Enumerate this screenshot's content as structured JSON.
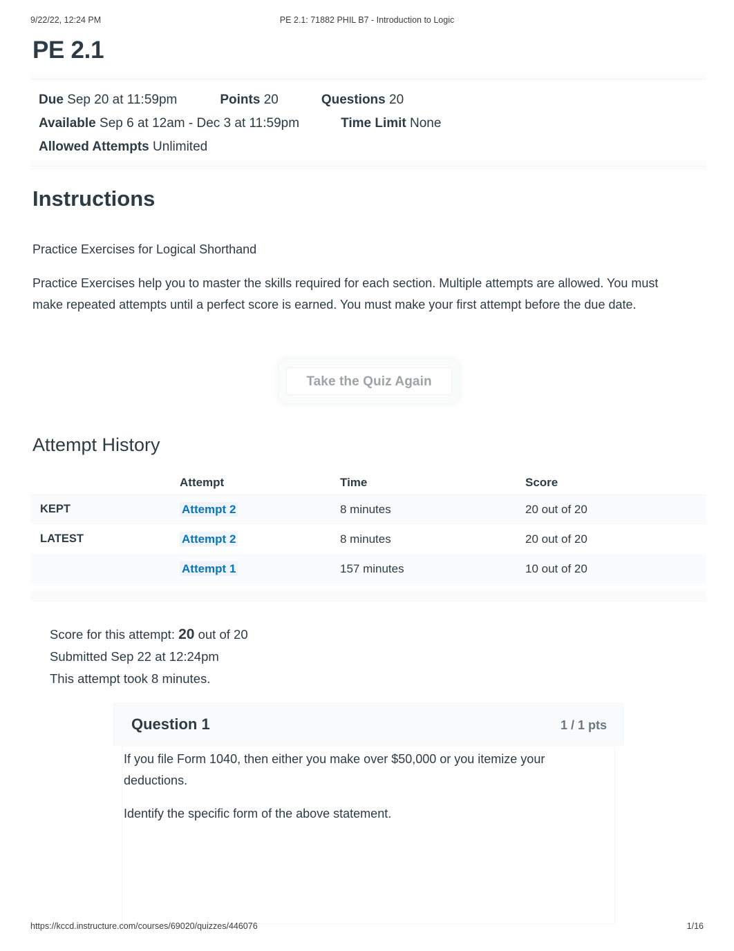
{
  "print_header": {
    "date": "9/22/22, 12:24 PM",
    "title": "PE 2.1: 71882 PHIL B7 - Introduction to Logic"
  },
  "quiz": {
    "title": "PE 2.1"
  },
  "meta": {
    "due_label": "Due",
    "due_value": "Sep 20 at 11:59pm",
    "points_label": "Points",
    "points_value": "20",
    "questions_label": "Questions",
    "questions_value": "20",
    "available_label": "Available",
    "available_value": "Sep 6 at 12am - Dec 3 at 11:59pm",
    "time_limit_label": "Time Limit",
    "time_limit_value": "None",
    "allowed_attempts_label": "Allowed Attempts",
    "allowed_attempts_value": "Unlimited"
  },
  "instructions": {
    "heading": "Instructions",
    "line1": "Practice Exercises for Logical Shorthand",
    "paragraph": "Practice Exercises help you to master the skills required for each section. Multiple attempts are allowed. You must make repeated attempts until a perfect score is earned. You must make your first attempt before the due date."
  },
  "actions": {
    "retake_label": "Take the Quiz Again"
  },
  "attempt_history": {
    "heading": "Attempt History",
    "columns": {
      "flag": "",
      "attempt": "Attempt",
      "time": "Time",
      "score": "Score"
    },
    "rows": [
      {
        "flag": "KEPT",
        "attempt": "Attempt 2",
        "time": "8 minutes",
        "score": "20 out of 20"
      },
      {
        "flag": "LATEST",
        "attempt": "Attempt 2",
        "time": "8 minutes",
        "score": "20 out of 20"
      },
      {
        "flag": "",
        "attempt": "Attempt 1",
        "time": "157 minutes",
        "score": "10 out of 20"
      }
    ]
  },
  "attempt_summary": {
    "score_prefix": "Score for this attempt:",
    "score_value": "20",
    "score_suffix": "out of 20",
    "submitted": "Submitted Sep 22 at 12:24pm",
    "duration": "This attempt took 8 minutes."
  },
  "question": {
    "title": "Question 1",
    "points": "1 / 1 pts",
    "body_1": "If you file Form 1040, then either you make over $50,000 or you itemize your deductions.",
    "body_2": "Identify the specific form of the above statement."
  },
  "print_footer": {
    "url": "https://kccd.instructure.com/courses/69020/quizzes/446076",
    "page": "1/16"
  },
  "colors": {
    "link": "#0b74b8",
    "text": "#2d3b45",
    "muted": "#6b7780",
    "disabled": "#9ea3a6"
  }
}
